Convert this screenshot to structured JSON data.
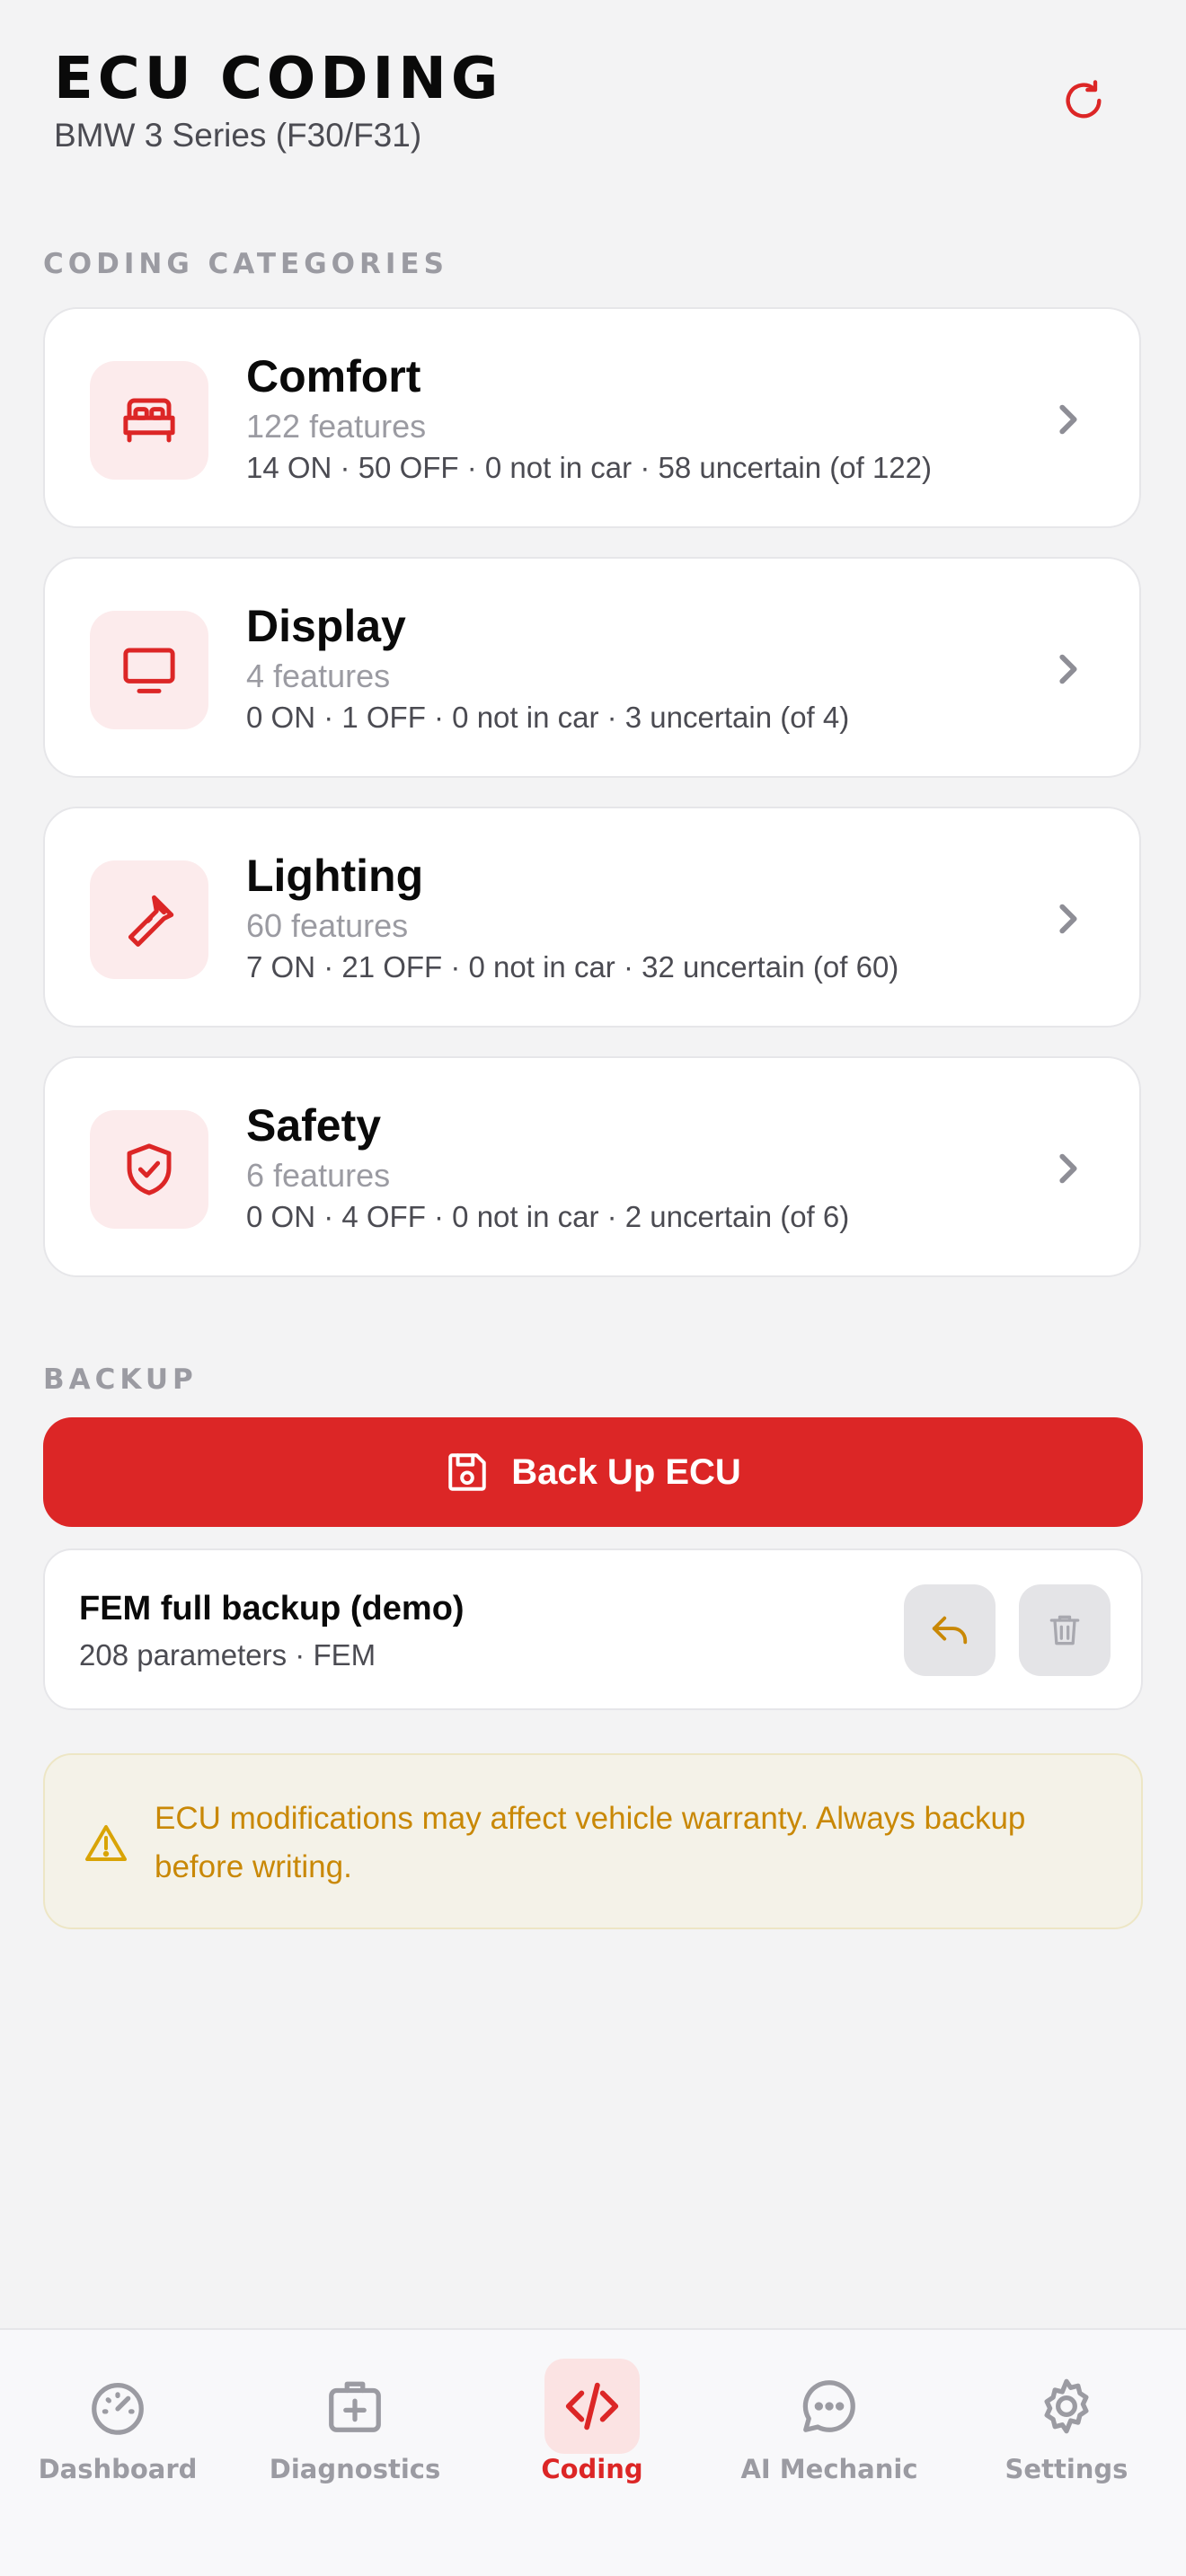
{
  "header": {
    "title": "ECU CODING",
    "subtitle": "BMW 3 Series (F30/F31)",
    "refresh_icon": "refresh-icon"
  },
  "sections": {
    "categories_label": "CODING CATEGORIES",
    "backup_label": "BACKUP"
  },
  "categories": [
    {
      "name": "Comfort",
      "count": "122 features",
      "stats": "14 ON · 50 OFF · 0 not in car · 58 uncertain (of 122)",
      "icon": "bed-icon"
    },
    {
      "name": "Display",
      "count": "4 features",
      "stats": "0 ON · 1 OFF · 0 not in car · 3 uncertain (of 4)",
      "icon": "monitor-icon"
    },
    {
      "name": "Lighting",
      "count": "60 features",
      "stats": "7 ON · 21 OFF · 0 not in car · 32 uncertain (of 60)",
      "icon": "flashlight-icon"
    },
    {
      "name": "Safety",
      "count": "6 features",
      "stats": "0 ON · 4 OFF · 0 not in car · 2 uncertain (of 6)",
      "icon": "shield-check-icon"
    }
  ],
  "backup": {
    "button_label": "Back Up ECU",
    "items": [
      {
        "title": "FEM full backup (demo)",
        "meta": "208 parameters · FEM"
      }
    ]
  },
  "warning": {
    "text": "ECU modifications may affect vehicle warranty. Always backup before writing."
  },
  "tabs": [
    {
      "label": "Dashboard",
      "icon": "gauge-icon",
      "active": false
    },
    {
      "label": "Diagnostics",
      "icon": "medical-kit-icon",
      "active": false
    },
    {
      "label": "Coding",
      "icon": "code-icon",
      "active": true
    },
    {
      "label": "AI Mechanic",
      "icon": "chat-bubble-icon",
      "active": false
    },
    {
      "label": "Settings",
      "icon": "gear-icon",
      "active": false
    }
  ],
  "colors": {
    "accent": "#dc2626",
    "background": "#f3f3f4",
    "warning_text": "#c98806"
  }
}
